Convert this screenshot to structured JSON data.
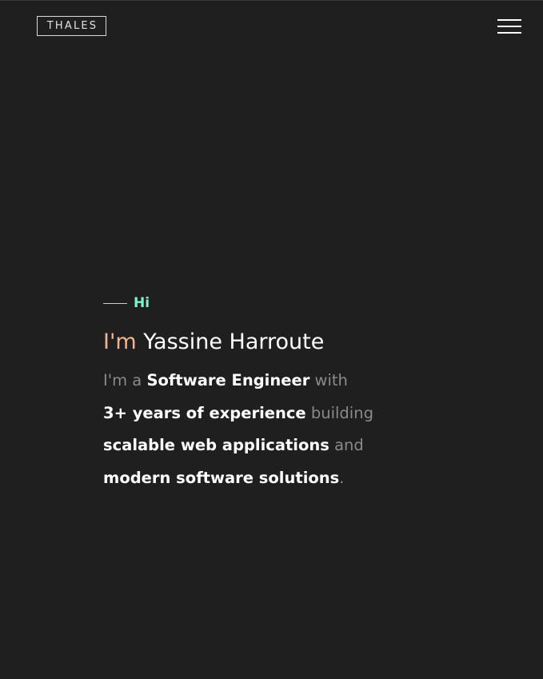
{
  "header": {
    "logo_text": "THALES",
    "menu_icon": "hamburger-menu-icon"
  },
  "hero": {
    "greeting": "Hi",
    "name_prefix": "I'm",
    "name": "Yassine Harroute",
    "bio": {
      "line1": {
        "part1": "I'm a",
        "highlight": "Software Engineer",
        "part2": "with"
      },
      "line2": {
        "highlight": "3+ years of experience",
        "part2": "building"
      },
      "line3": {
        "highlight": "scalable web applications",
        "part2": "and"
      },
      "line4": {
        "highlight": "modern software solutions",
        "part2": "."
      }
    }
  },
  "colors": {
    "background": "#1f1f1f",
    "accent_green": "#7ff3cf",
    "accent_peach": "#f0b595",
    "text_primary": "#ffffff",
    "text_muted": "#8a8a8a"
  }
}
